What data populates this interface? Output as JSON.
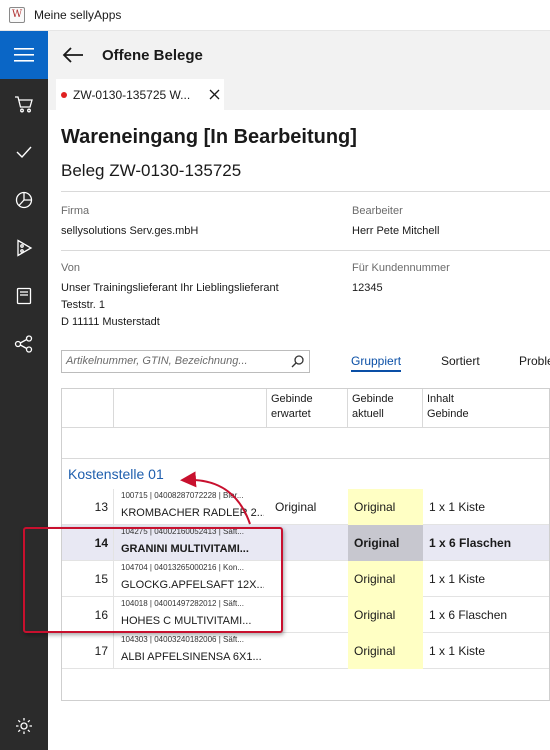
{
  "window": {
    "title": "Meine sellyApps"
  },
  "colors": {
    "accent": "#0a66c6",
    "rail": "#2b2b2b",
    "highlight": "#c8102e",
    "link": "#1f5fae",
    "unsaved_dot": "#e02020",
    "actual_cell": "#ffffc4"
  },
  "rail": {
    "icons": [
      "hamburger-menu-icon",
      "shopping-cart-icon",
      "checkmark-icon",
      "pie-chart-icon",
      "pizza-slice-icon",
      "book-icon",
      "share-nodes-icon",
      "gear-icon"
    ]
  },
  "header": {
    "title": "Offene Belege"
  },
  "tab": {
    "label": "ZW-0130-135725 W..."
  },
  "document": {
    "title": "Wareneingang [In Bearbeitung]",
    "subtitle": "Beleg ZW-0130-135725"
  },
  "fields": {
    "firma_label": "Firma",
    "firma_value": "sellysolutions Serv.ges.mbH",
    "bearbeiter_label": "Bearbeiter",
    "bearbeiter_value": "Herr Pete Mitchell",
    "von_label": "Von",
    "von_line1": "Unser Trainingslieferant Ihr Lieblingslieferant",
    "von_line2": "Teststr. 1",
    "von_line3": "D 11111 Musterstadt",
    "kunde_label": "Für Kundennummer",
    "kunde_value": "12345"
  },
  "search": {
    "placeholder": "Artikelnummer, GTIN, Bezeichnung..."
  },
  "view_tabs": {
    "grouped": "Gruppiert",
    "sorted": "Sortiert",
    "problems": "Proble"
  },
  "grid": {
    "headers": {
      "gebinde_erwartet_1": "Gebinde",
      "gebinde_erwartet_2": "erwartet",
      "gebinde_aktuell_1": "Gebinde",
      "gebinde_aktuell_2": "aktuell",
      "inhalt_1": "Inhalt",
      "inhalt_2": "Gebinde"
    },
    "group_title": "Kostenstelle 01",
    "rows": [
      {
        "num": "13",
        "meta": "100715 | 04008287072228 | Bier...",
        "title": "KROMBACHER RADLER 2...",
        "erwartet": "Original",
        "aktuell": "Original",
        "inhalt": "1 x 1 Kiste",
        "selected": false
      },
      {
        "num": "14",
        "meta": "104275 | 04002160052413 | Säft...",
        "title": "GRANINI MULTIVITAMI...",
        "erwartet": "",
        "aktuell": "Original",
        "inhalt": "1 x 6 Flaschen",
        "selected": true
      },
      {
        "num": "15",
        "meta": "104704 | 04013265000216 | Kon...",
        "title": "GLOCKG.APFELSAFT 12X...",
        "erwartet": "",
        "aktuell": "Original",
        "inhalt": "1 x 1 Kiste",
        "selected": false
      },
      {
        "num": "16",
        "meta": "104018 | 04001497282012 | Säft...",
        "title": "HOHES C MULTIVITAMI...",
        "erwartet": "",
        "aktuell": "Original",
        "inhalt": "1 x 6 Flaschen",
        "selected": false
      },
      {
        "num": "17",
        "meta": "104303 | 04003240182006 | Säft...",
        "title": "ALBI APFELSINENSA 6X1...",
        "erwartet": "",
        "aktuell": "Original",
        "inhalt": "1 x 1 Kiste",
        "selected": false
      }
    ]
  }
}
